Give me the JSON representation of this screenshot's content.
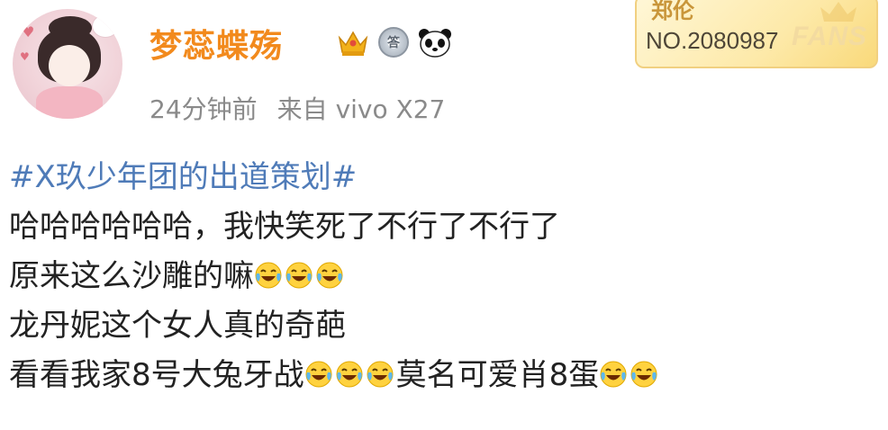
{
  "user": {
    "name": "梦蕊蝶殇",
    "time": "24分钟前",
    "source_prefix": "来自",
    "source_device": "vivo X27"
  },
  "badges": [
    "crown-icon",
    "medal-icon",
    "panda-icon"
  ],
  "medal_text": "答",
  "fans_card": {
    "name": "郑伦",
    "number": "NO.2080987",
    "label": "FANS"
  },
  "post": {
    "hashtag": "#X玖少年团的出道策划#",
    "line2": "哈哈哈哈哈哈，我快笑死了不行了不行了",
    "line3": "原来这么沙雕的嘛",
    "line4": "龙丹妮这个女人真的奇葩",
    "line5_a": "看看我家8号大兔牙战",
    "line5_b": "莫名可爱肖8蛋"
  },
  "colors": {
    "username": "#f28a1d",
    "hashtag": "#4f7bb8",
    "meta": "#8a8a8a",
    "text": "#222222"
  },
  "emoji": "laugh-cry-icon"
}
